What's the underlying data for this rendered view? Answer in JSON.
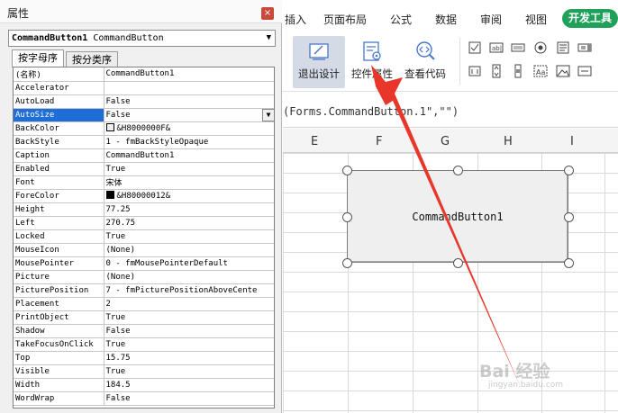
{
  "properties_panel": {
    "title": "属性",
    "object_selector": {
      "name": "CommandButton1",
      "type": "CommandButton"
    },
    "tabs": [
      "按字母序",
      "按分类序"
    ],
    "rows": [
      {
        "k": "(名称)",
        "v": "CommandButton1"
      },
      {
        "k": "Accelerator",
        "v": ""
      },
      {
        "k": "AutoLoad",
        "v": "False"
      },
      {
        "k": "AutoSize",
        "v": "False"
      },
      {
        "k": "BackColor",
        "v": "&H8000000F&"
      },
      {
        "k": "BackStyle",
        "v": "1 - fmBackStyleOpaque"
      },
      {
        "k": "Caption",
        "v": "CommandButton1"
      },
      {
        "k": "Enabled",
        "v": "True"
      },
      {
        "k": "Font",
        "v": "宋体"
      },
      {
        "k": "ForeColor",
        "v": "&H80000012&"
      },
      {
        "k": "Height",
        "v": "77.25"
      },
      {
        "k": "Left",
        "v": "270.75"
      },
      {
        "k": "Locked",
        "v": "True"
      },
      {
        "k": "MouseIcon",
        "v": "(None)"
      },
      {
        "k": "MousePointer",
        "v": "0 - fmMousePointerDefault"
      },
      {
        "k": "Picture",
        "v": "(None)"
      },
      {
        "k": "PicturePosition",
        "v": "7 - fmPicturePositionAboveCente"
      },
      {
        "k": "Placement",
        "v": "2"
      },
      {
        "k": "PrintObject",
        "v": "True"
      },
      {
        "k": "Shadow",
        "v": "False"
      },
      {
        "k": "TakeFocusOnClick",
        "v": "True"
      },
      {
        "k": "Top",
        "v": "15.75"
      },
      {
        "k": "Visible",
        "v": "True"
      },
      {
        "k": "Width",
        "v": "184.5"
      },
      {
        "k": "WordWrap",
        "v": "False"
      }
    ],
    "selected_property": "AutoSize",
    "swatch_colors": {
      "BackColor": "#f0f0f0",
      "ForeColor": "#000000"
    }
  },
  "ribbon": {
    "tabs": [
      "插入",
      "页面布局",
      "公式",
      "数据",
      "审阅",
      "视图",
      "开发工具"
    ],
    "buttons": [
      {
        "label": "退出设计",
        "icon": "design-mode-icon"
      },
      {
        "label": "控件属性",
        "icon": "control-properties-icon"
      },
      {
        "label": "查看代码",
        "icon": "view-code-icon"
      }
    ],
    "accent": "#1fa15a"
  },
  "formula_bar": {
    "text": "(Forms.CommandButton.1\",\"\")"
  },
  "sheet": {
    "columns": [
      "E",
      "F",
      "G",
      "H",
      "I"
    ]
  },
  "command_button": {
    "caption": "CommandButton1"
  },
  "watermark": {
    "text": "Bai 经验",
    "sub": "jingyan.baidu.com"
  },
  "annotation": {
    "arrow_color": "#e8372a"
  }
}
